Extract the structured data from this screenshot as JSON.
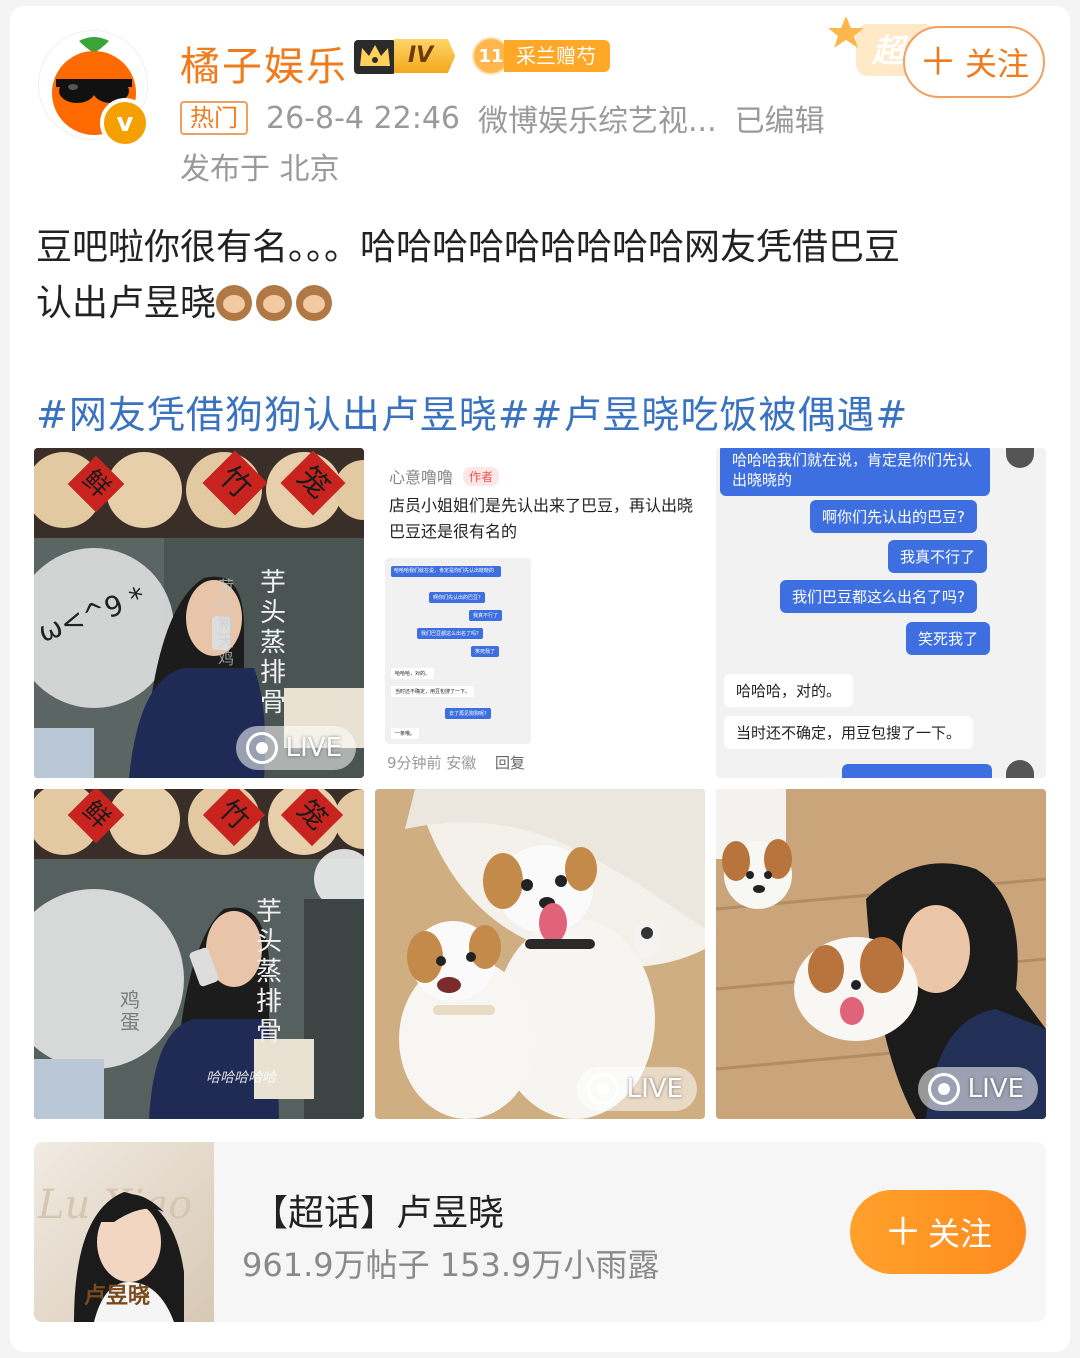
{
  "header": {
    "username": "橘子娱乐",
    "level_badge": "IV",
    "fan_badge_level": "11",
    "fan_badge_text": "采兰赠芍",
    "super_deco_text": "超",
    "follow_icon": "plus-icon",
    "follow_label": "关注",
    "hot_tag": "热门",
    "timestamp": "26-8-4 22:46",
    "source": "微博娱乐综艺视...",
    "edited": "已编辑",
    "location": "发布于 北京",
    "verified_mark": "v"
  },
  "post": {
    "text_line1": "豆吧啦你很有名。。。哈哈哈哈哈哈哈哈哈网友凭借巴豆",
    "text_line2": "认出卢昱晓",
    "hashtags": "#网友凭借狗狗认出卢昱晓##卢昱晓吃饭被偶遇#"
  },
  "images": {
    "live_label": "LIVE",
    "tile1": {
      "sign_fresh": "鲜",
      "sign_bamboo": "竹",
      "sign_cage": "笼",
      "menu_text": "芋头蒸排骨",
      "side_text": "荷叶新天鸡",
      "sticker": "ω<^9 *"
    },
    "tile2": {
      "user": "心意噜噜",
      "author_tag": "作者",
      "comment_line1": "店员小姐姐们是先认出来了巴豆，再认出晓",
      "comment_line2": "巴豆还是很有名的",
      "mini_chat": [
        "哈哈哈我们就在说，肯定是你们先认出晓晓的",
        "啊你们先认出的巴豆?",
        "我真不行了",
        "我们巴豆都这么出名了吗?",
        "笑死我了",
        "哈哈哈，对的。",
        "当时还不确定，用豆包搜了一下。",
        "去了再见狗狗呢?",
        "一条哦。"
      ],
      "time_place": "9分钟前 安徽",
      "reply": "回复"
    },
    "tile3": {
      "bubbles_right": [
        "哈哈哈我们就在说，肯定是你们先认出晓晓的",
        "啊你们先认出的巴豆?",
        "我真不行了",
        "我们巴豆都这么出名了吗?",
        "笑死我了"
      ],
      "bubbles_left": [
        "哈哈哈，对的。",
        "当时还不确定，用豆包搜了一下。"
      ]
    },
    "tile4": {
      "sign_fresh": "鲜",
      "sign_bamboo": "竹",
      "sign_cage": "笼",
      "menu_text": "芋头蒸排骨",
      "side_text": "鸡蛋",
      "caption": "哈哈哈哈哈"
    }
  },
  "topic": {
    "title": "【超话】卢昱晓",
    "stats": "961.9万帖子 153.9万小雨露",
    "thumb_name": "卢昱晓",
    "thumb_bg_text": "Lu Xiao",
    "follow_icon": "plus-icon",
    "follow_label": "关注"
  },
  "colors": {
    "accent": "#ef7b1c",
    "hashtag": "#3a72c2",
    "chat_blue": "#3d6fe0"
  }
}
